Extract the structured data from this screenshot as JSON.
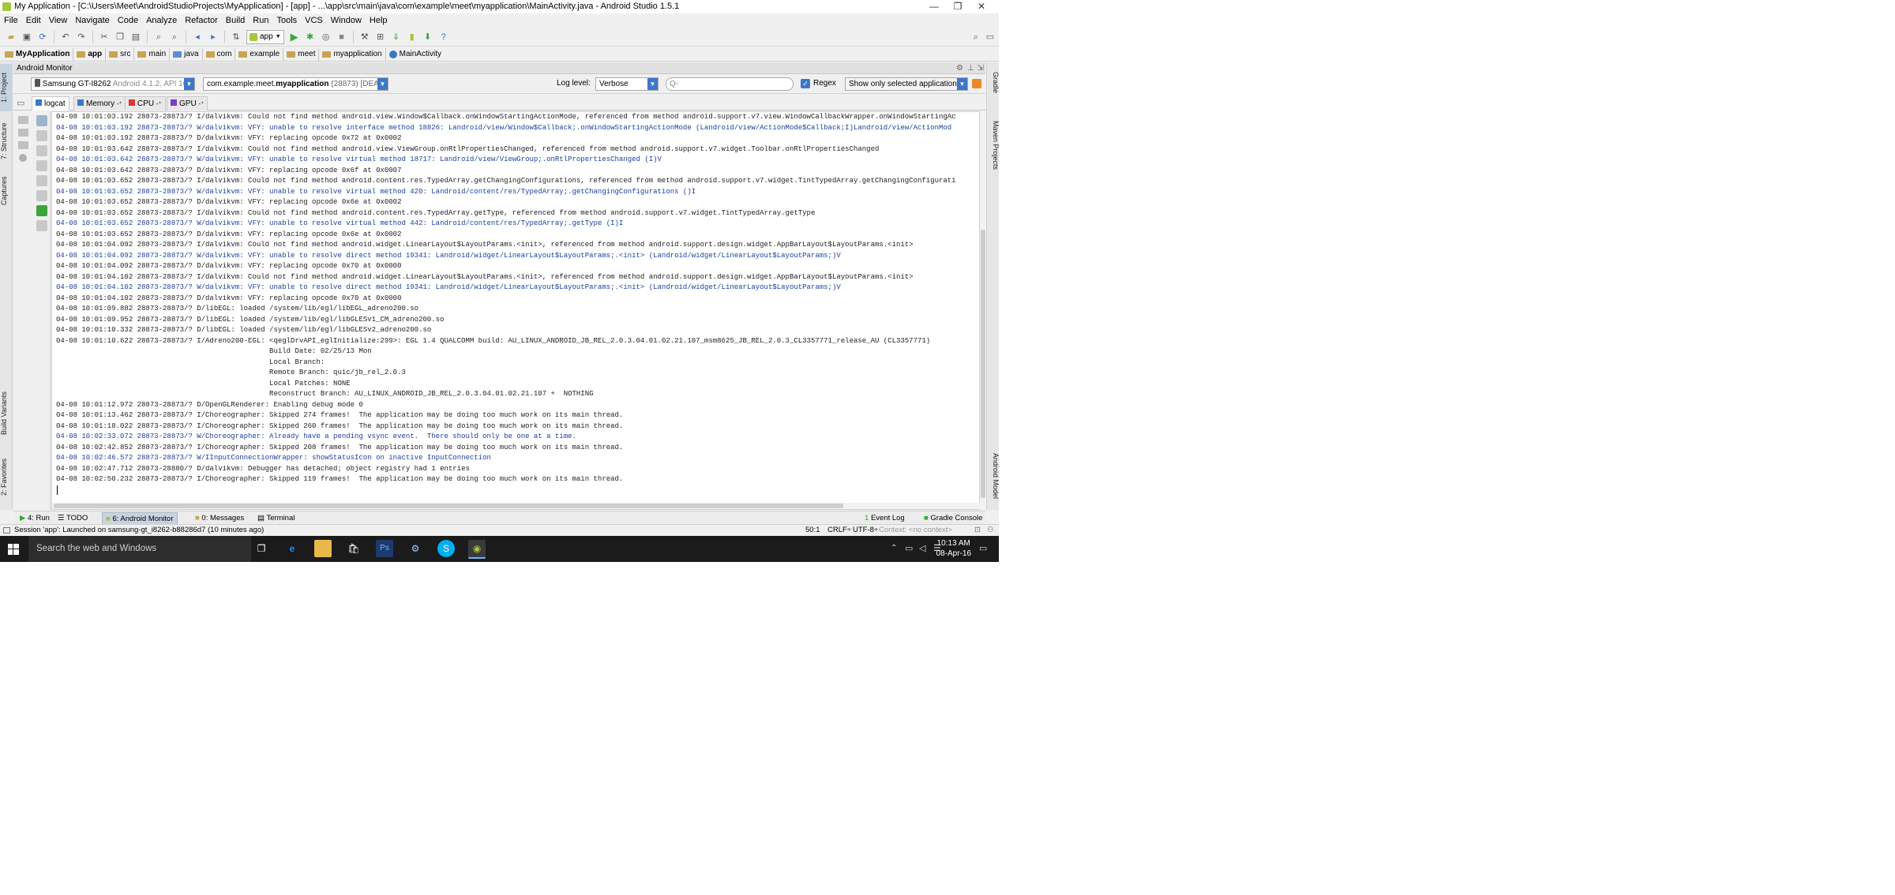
{
  "window": {
    "title": "My Application - [C:\\Users\\Meet\\AndroidStudioProjects\\MyApplication] - [app] - ...\\app\\src\\main\\java\\com\\example\\meet\\myapplication\\MainActivity.java - Android Studio 1.5.1",
    "minimize": "—",
    "maximize": "❐",
    "close": "✕"
  },
  "menu": [
    "File",
    "Edit",
    "View",
    "Navigate",
    "Code",
    "Analyze",
    "Refactor",
    "Build",
    "Run",
    "Tools",
    "VCS",
    "Window",
    "Help"
  ],
  "toolbar": {
    "run_config": "app"
  },
  "breadcrumb": [
    "MyApplication",
    "app",
    "src",
    "main",
    "java",
    "com",
    "example",
    "meet",
    "myapplication",
    "MainActivity"
  ],
  "left_strip": {
    "project": "1: Project",
    "structure": "7: Structure",
    "captures": "Captures",
    "build_variants": "Build Variants",
    "favorites": "2: Favorites"
  },
  "right_strip": {
    "gradle": "Gradle",
    "maven": "Maven Projects",
    "android_model": "Android Model"
  },
  "monitor": {
    "header": "Android Monitor",
    "device": "Samsung GT-I8262",
    "device_api": "Android 4.1.2, API 16",
    "process_pkg": "com.example.meet.",
    "process_name": "myapplication",
    "process_suffix": "(28873) [DEAD]",
    "log_level_label": "Log level:",
    "log_level": "Verbose",
    "search_placeholder": "Q-",
    "regex_label": "Regex",
    "filter": "Show only selected application",
    "tabs": [
      "logcat",
      "Memory",
      "CPU",
      "GPU"
    ]
  },
  "log_lines": [
    {
      "level": "i",
      "text": "04-08 10:01:03.192 28873-28873/? I/dalvikvm: Could not find method android.view.Window$Callback.onWindowStartingActionMode, referenced from method android.support.v7.view.WindowCallbackWrapper.onWindowStartingAc"
    },
    {
      "level": "w",
      "text": "04-08 10:01:03.192 28873-28873/? W/dalvikvm: VFY: unable to resolve interface method 18826: Landroid/view/Window$Callback;.onWindowStartingActionMode (Landroid/view/ActionMode$Callback;I)Landroid/view/ActionMod"
    },
    {
      "level": "d",
      "text": "04-08 10:01:03.192 28873-28873/? D/dalvikvm: VFY: replacing opcode 0x72 at 0x0002"
    },
    {
      "level": "i",
      "text": "04-08 10:01:03.642 28873-28873/? I/dalvikvm: Could not find method android.view.ViewGroup.onRtlPropertiesChanged, referenced from method android.support.v7.widget.Toolbar.onRtlPropertiesChanged"
    },
    {
      "level": "w",
      "text": "04-08 10:01:03.642 28873-28873/? W/dalvikvm: VFY: unable to resolve virtual method 18717: Landroid/view/ViewGroup;.onRtlPropertiesChanged (I)V"
    },
    {
      "level": "d",
      "text": "04-08 10:01:03.642 28873-28873/? D/dalvikvm: VFY: replacing opcode 0x6f at 0x0007"
    },
    {
      "level": "i",
      "text": "04-08 10:01:03.652 28873-28873/? I/dalvikvm: Could not find method android.content.res.TypedArray.getChangingConfigurations, referenced from method android.support.v7.widget.TintTypedArray.getChangingConfigurati"
    },
    {
      "level": "w",
      "text": "04-08 10:01:03.652 28873-28873/? W/dalvikvm: VFY: unable to resolve virtual method 420: Landroid/content/res/TypedArray;.getChangingConfigurations ()I"
    },
    {
      "level": "d",
      "text": "04-08 10:01:03.652 28873-28873/? D/dalvikvm: VFY: replacing opcode 0x6e at 0x0002"
    },
    {
      "level": "i",
      "text": "04-08 10:01:03.652 28873-28873/? I/dalvikvm: Could not find method android.content.res.TypedArray.getType, referenced from method android.support.v7.widget.TintTypedArray.getType"
    },
    {
      "level": "w",
      "text": "04-08 10:01:03.652 28873-28873/? W/dalvikvm: VFY: unable to resolve virtual method 442: Landroid/content/res/TypedArray;.getType (I)I"
    },
    {
      "level": "d",
      "text": "04-08 10:01:03.652 28873-28873/? D/dalvikvm: VFY: replacing opcode 0x6e at 0x0002"
    },
    {
      "level": "i",
      "text": "04-08 10:01:04.092 28873-28873/? I/dalvikvm: Could not find method android.widget.LinearLayout$LayoutParams.<init>, referenced from method android.support.design.widget.AppBarLayout$LayoutParams.<init>"
    },
    {
      "level": "w",
      "text": "04-08 10:01:04.092 28873-28873/? W/dalvikvm: VFY: unable to resolve direct method 19341: Landroid/widget/LinearLayout$LayoutParams;.<init> (Landroid/widget/LinearLayout$LayoutParams;)V"
    },
    {
      "level": "d",
      "text": "04-08 10:01:04.092 28873-28873/? D/dalvikvm: VFY: replacing opcode 0x70 at 0x0000"
    },
    {
      "level": "i",
      "text": "04-08 10:01:04.102 28873-28873/? I/dalvikvm: Could not find method android.widget.LinearLayout$LayoutParams.<init>, referenced from method android.support.design.widget.AppBarLayout$LayoutParams.<init>"
    },
    {
      "level": "w",
      "text": "04-08 10:01:04.102 28873-28873/? W/dalvikvm: VFY: unable to resolve direct method 19341: Landroid/widget/LinearLayout$LayoutParams;.<init> (Landroid/widget/LinearLayout$LayoutParams;)V"
    },
    {
      "level": "d",
      "text": "04-08 10:01:04.102 28873-28873/? D/dalvikvm: VFY: replacing opcode 0x70 at 0x0000"
    },
    {
      "level": "d",
      "text": "04-08 10:01:09.882 28873-28873/? D/libEGL: loaded /system/lib/egl/libEGL_adreno200.so"
    },
    {
      "level": "d",
      "text": "04-08 10:01:09.952 28873-28873/? D/libEGL: loaded /system/lib/egl/libGLESv1_CM_adreno200.so"
    },
    {
      "level": "d",
      "text": "04-08 10:01:10.332 28873-28873/? D/libEGL: loaded /system/lib/egl/libGLESv2_adreno200.so"
    },
    {
      "level": "i",
      "text": "04-08 10:01:10.622 28873-28873/? I/Adreno200-EGL: <qeglDrvAPI_eglInitialize:299>: EGL 1.4 QUALCOMM build: AU_LINUX_ANDROID_JB_REL_2.0.3.04.01.02.21.107_msm8625_JB_REL_2.0.3_CL3357771_release_AU (CL3357771)"
    },
    {
      "level": "i",
      "text": "                                                  Build Date: 02/25/13 Mon"
    },
    {
      "level": "i",
      "text": "                                                  Local Branch:"
    },
    {
      "level": "i",
      "text": "                                                  Remote Branch: quic/jb_rel_2.0.3"
    },
    {
      "level": "i",
      "text": "                                                  Local Patches: NONE"
    },
    {
      "level": "i",
      "text": "                                                  Reconstruct Branch: AU_LINUX_ANDROID_JB_REL_2.0.3.04.01.02.21.107 +  NOTHING"
    },
    {
      "level": "d",
      "text": "04-08 10:01:12.972 28873-28873/? D/OpenGLRenderer: Enabling debug mode 0"
    },
    {
      "level": "i",
      "text": "04-08 10:01:13.462 28873-28873/? I/Choreographer: Skipped 274 frames!  The application may be doing too much work on its main thread."
    },
    {
      "level": "i",
      "text": "04-08 10:01:18.022 28873-28873/? I/Choreographer: Skipped 260 frames!  The application may be doing too much work on its main thread."
    },
    {
      "level": "w",
      "text": "04-08 10:02:33.072 28873-28873/? W/Choreographer: Already have a pending vsync event.  There should only be one at a time."
    },
    {
      "level": "i",
      "text": "04-08 10:02:42.852 28873-28873/? I/Choreographer: Skipped 208 frames!  The application may be doing too much work on its main thread."
    },
    {
      "level": "w",
      "text": "04-08 10:02:46.572 28873-28873/? W/IInputConnectionWrapper: showStatusIcon on inactive InputConnection"
    },
    {
      "level": "d",
      "text": "04-08 10:02:47.712 28873-28880/? D/dalvikvm: Debugger has detached; object registry had 1 entries"
    },
    {
      "level": "i",
      "text": "04-08 10:02:50.232 28873-28873/? I/Choreographer: Skipped 119 frames!  The application may be doing too much work on its main thread."
    }
  ],
  "bottom_tabs": [
    "4: Run",
    "TODO",
    "6: Android Monitor",
    "0: Messages",
    "Terminal"
  ],
  "bottom_right_tabs": [
    "Event Log",
    "Gradle Console"
  ],
  "status": {
    "message": "Session 'app': Launched on samsung-gt_i8262-b88286d7 (10 minutes ago)",
    "position": "50:1",
    "line_sep": "CRLF÷",
    "encoding": "UTF-8÷",
    "context": "Context: <no context>"
  },
  "taskbar": {
    "search": "Search the web and Windows",
    "time": "10:13 AM",
    "date": "08-Apr-16"
  },
  "colors": {
    "accent": "#3c78c8",
    "warn_text": "#1e3e9e",
    "taskbar": "#1b1b1b"
  }
}
